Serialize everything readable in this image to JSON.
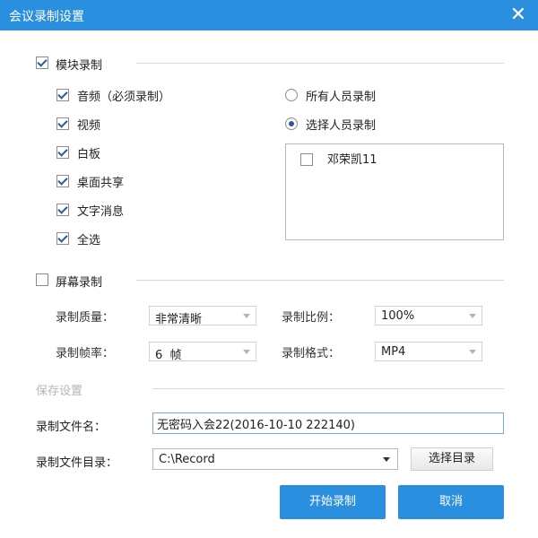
{
  "window": {
    "title": "会议录制设置",
    "close_symbol": "✕"
  },
  "module_recording": {
    "label": "模块录制",
    "checked": true,
    "items": [
      {
        "label": "音频（必须录制）",
        "checked": true
      },
      {
        "label": "视频",
        "checked": true
      },
      {
        "label": "白板",
        "checked": true
      },
      {
        "label": "桌面共享",
        "checked": true
      },
      {
        "label": "文字消息",
        "checked": true
      },
      {
        "label": "全选",
        "checked": true
      }
    ],
    "participants": {
      "all_label": "所有人员录制",
      "select_label": "选择人员录制",
      "selected": "select",
      "members": [
        {
          "name": "邓荣凯11",
          "checked": false
        }
      ]
    }
  },
  "screen_recording": {
    "label": "屏幕录制",
    "checked": false,
    "quality": {
      "label": "录制质量：",
      "value": "非常清晰"
    },
    "ratio": {
      "label": "录制比例：",
      "value": "100%"
    },
    "framerate": {
      "label": "录制帧率：",
      "value": "6  帧"
    },
    "format": {
      "label": "录制格式：",
      "value": "MP4"
    }
  },
  "save_settings": {
    "label": "保存设置",
    "filename": {
      "label": "录制文件名：",
      "value": "无密码入会22(2016-10-10 222140)"
    },
    "directory": {
      "label": "录制文件目录：",
      "value": "C:\\Record",
      "browse_label": "选择目录"
    }
  },
  "actions": {
    "start_label": "开始录制",
    "cancel_label": "取消"
  },
  "colors": {
    "accent": "#2b8fe0",
    "check": "#2a5a9a"
  }
}
